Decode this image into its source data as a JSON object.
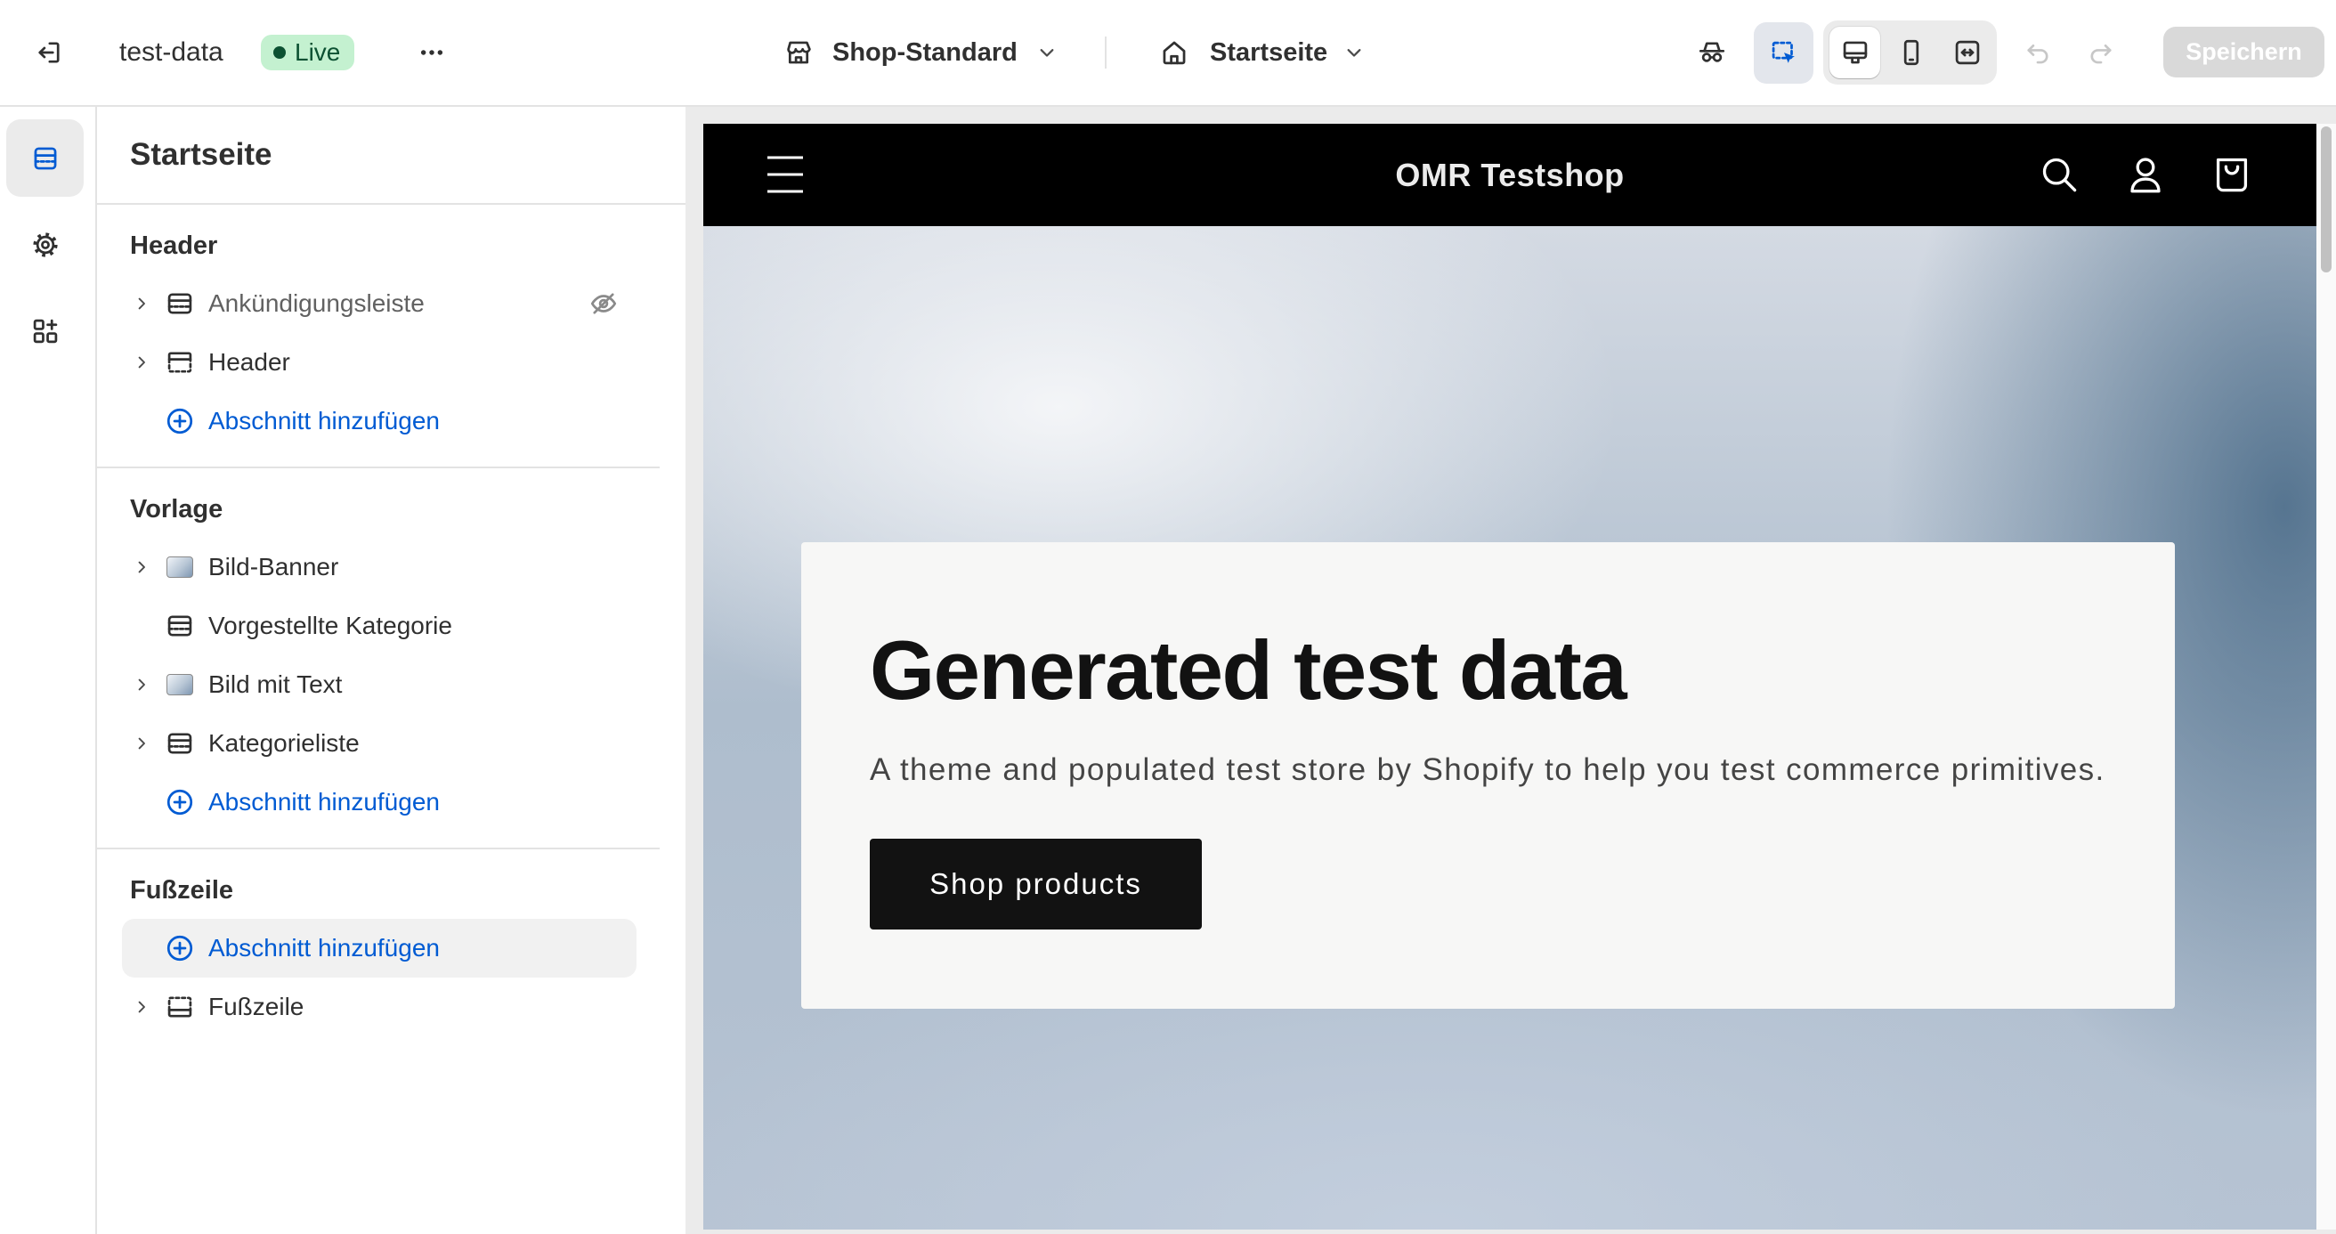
{
  "topbar": {
    "exit_icon": "exit-icon",
    "store_name": "test-data",
    "status": "Live",
    "more_icon": "more-horizontal-icon",
    "theme": {
      "icon": "store-icon",
      "label": "Shop-Standard"
    },
    "page": {
      "icon": "home-icon",
      "label": "Startseite"
    },
    "tools": {
      "preview_icon": "incognito-icon",
      "inspector_icon": "inspector-icon",
      "inspector_active": true,
      "devices": [
        {
          "icon": "desktop-icon",
          "active": true
        },
        {
          "icon": "mobile-icon",
          "active": false
        },
        {
          "icon": "fullscreen-icon",
          "active": false
        }
      ],
      "undo_icon": "undo-icon",
      "undo_enabled": false,
      "redo_icon": "redo-icon",
      "redo_enabled": false
    },
    "save_label": "Speichern",
    "save_enabled": false
  },
  "rail": [
    {
      "icon": "sections-icon",
      "active": true
    },
    {
      "icon": "gear-icon",
      "active": false
    },
    {
      "icon": "apps-icon",
      "active": false
    }
  ],
  "sidebar": {
    "title": "Startseite",
    "groups": [
      {
        "heading": "Header",
        "items": [
          {
            "label": "Ankündigungsleiste",
            "icon": "section-icon",
            "expandable": true,
            "hidden": true
          },
          {
            "label": "Header",
            "icon": "header-section-icon",
            "expandable": true
          }
        ],
        "add_label": "Abschnitt hinzufügen"
      },
      {
        "heading": "Vorlage",
        "items": [
          {
            "label": "Bild-Banner",
            "icon": "image-icon",
            "expandable": true
          },
          {
            "label": "Vorgestellte Kategorie",
            "icon": "section-icon",
            "expandable": false
          },
          {
            "label": "Bild mit Text",
            "icon": "image-icon",
            "expandable": true
          },
          {
            "label": "Kategorieliste",
            "icon": "section-icon",
            "expandable": true
          }
        ],
        "add_label": "Abschnitt hinzufügen"
      },
      {
        "heading": "Fußzeile",
        "add_label": "Abschnitt hinzufügen",
        "add_highlighted": true,
        "items": [
          {
            "label": "Fußzeile",
            "icon": "footer-section-icon",
            "expandable": true
          }
        ]
      }
    ]
  },
  "preview": {
    "store_title": "OMR Testshop",
    "menu_icon": "hamburger-icon",
    "header_icons": [
      "search-icon",
      "account-icon",
      "cart-icon"
    ],
    "hero": {
      "heading": "Generated test data",
      "text": "A theme and populated test store by Shopify to help you test commerce primitives.",
      "button": "Shop products"
    }
  },
  "colors": {
    "accent": "#005bd3",
    "live_badge_bg": "#c4f1d0",
    "live_badge_text": "#0c5132",
    "store_header_bg": "#000000",
    "hero_card_bg": "#f7f7f6",
    "hero_button_bg": "#121212"
  }
}
